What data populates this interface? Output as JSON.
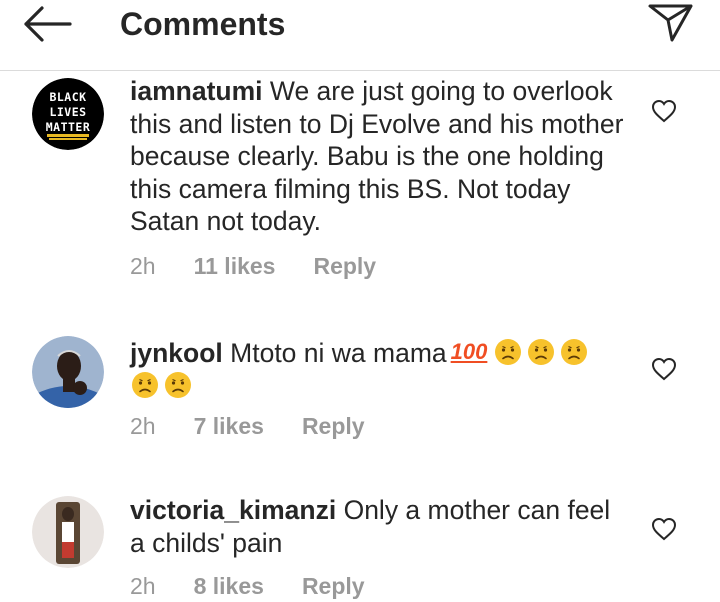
{
  "header": {
    "title": "Comments",
    "back_icon": "arrow-left-icon",
    "send_icon": "send-direct-icon"
  },
  "comments": [
    {
      "avatar_text": [
        "BLACK",
        "LIVES",
        "MATTER"
      ],
      "username": "iamnatumi",
      "text": "We are just going to overlook this and listen to Dj Evolve and his mother because clearly. Babu is the one holding this camera filming this BS. Not today Satan not today.",
      "time": "2h",
      "likes": "11 likes",
      "reply": "Reply"
    },
    {
      "username": "jynkool",
      "text": "Mtoto ni wa mama",
      "hundred_emoji": "100",
      "frowning_emoji_count": 5,
      "time": "2h",
      "likes": "7 likes",
      "reply": "Reply"
    },
    {
      "username": "victoria_kimanzi",
      "text": "Only a mother can feel a childs' pain",
      "time": "2h",
      "likes": "8 likes",
      "reply": "Reply"
    }
  ],
  "colors": {
    "text": "#262626",
    "meta": "#999999",
    "divider": "#dbdbdb",
    "emoji_face": "#f7c22c",
    "hundred": "#f04e23"
  }
}
